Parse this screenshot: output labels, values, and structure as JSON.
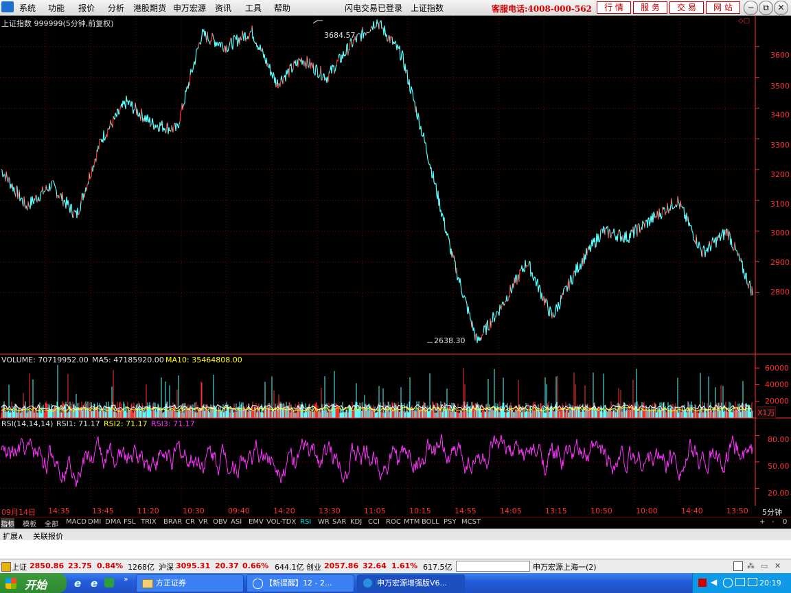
{
  "menu": {
    "items": [
      "系统",
      "功能",
      "报价",
      "分析",
      "港股期货",
      "申万宏源",
      "资讯",
      "工具",
      "帮助"
    ],
    "center_status": "闪电交易已登录",
    "center_title": "上证指数",
    "hotline": "客服电话:4008-000-562",
    "top_buttons": [
      "行 情",
      "服 务",
      "交 易",
      "网 站"
    ],
    "window_buttons": [
      "−",
      "⧉",
      "✕"
    ]
  },
  "chart": {
    "header": "上证指数 999999(5分钟,前复权)",
    "high_label": "3684.57",
    "low_label": "2638.30",
    "price_ticks": [
      "3600",
      "3500",
      "3400",
      "3300",
      "3200",
      "3100",
      "3000",
      "2900",
      "2800"
    ],
    "volume_header": {
      "volume": "VOLUME: 70719952.00",
      "ma5": "MA5: 47185920.00",
      "ma10": "MA10: 35464808.00"
    },
    "volume_ticks": [
      "60000",
      "40000",
      "20000"
    ],
    "volume_unit": "X1万",
    "rsi_header": {
      "name": "RSI(14,14,14)",
      "rsi1": "RSI1: 71.17",
      "rsi2": "RSI2: 71.17",
      "rsi3": "RSI3: 71.17"
    },
    "rsi_ticks": [
      "80.00",
      "50.00",
      "20.00"
    ],
    "time_labels": [
      "09月14日",
      "14:35",
      "13:45",
      "11:20",
      "10:30",
      "09:40",
      "14:20",
      "13:30",
      "11:05",
      "10:15",
      "14:55",
      "14:05",
      "13:15",
      "10:50",
      "10:00",
      "14:40",
      "13:50"
    ],
    "period": "5分钟",
    "colors": {
      "up": "#ff3232",
      "down": "#54ffff",
      "ma5": "#ffffff",
      "ma10": "#ffff00",
      "rsi": "#ff33ff",
      "grid": "#7a0000",
      "axis": "#ff3232"
    }
  },
  "chart_data": {
    "type": "line",
    "title": "上证指数 999999(5分钟,前复权)",
    "ylabel": "",
    "ylim": [
      2600,
      3700
    ],
    "x": [
      "09月14日",
      "14:35",
      "13:45",
      "11:20",
      "10:30",
      "09:40",
      "14:20",
      "13:30",
      "11:05",
      "10:15",
      "14:55",
      "14:05",
      "13:15",
      "10:50",
      "10:00",
      "14:40",
      "13:50"
    ],
    "series": [
      {
        "values": [
          3200,
          3080,
          3150,
          3050,
          3300,
          3420,
          3350,
          3330,
          3640,
          3600,
          3650,
          3480,
          3560,
          3500,
          3610,
          3684,
          3570,
          3260,
          2920,
          2640,
          2760,
          2900,
          2720,
          2880,
          3000,
          2980,
          3040,
          3100,
          2930,
          3000,
          2800
        ]
      }
    ],
    "annotations": [
      {
        "text": "3684.57",
        "y": 3684.57
      },
      {
        "text": "2638.30",
        "y": 2638.3
      }
    ],
    "volume_ylim": [
      0,
      70000
    ],
    "rsi_ylim": [
      0,
      100
    ],
    "rsi_ticks": [
      80,
      50,
      20
    ]
  },
  "tabs": [
    "指标",
    "模板",
    "全部",
    "MACD",
    "DMI",
    "DMA",
    "FSL",
    "TRIX",
    "BRAR",
    "CR",
    "VR",
    "OBV",
    "ASI",
    "EMV",
    "VOL-TDX",
    "RSI",
    "WR",
    "SAR",
    "KDJ",
    "CCI",
    "ROC",
    "MTM",
    "BOLL",
    "PSY",
    "MCST"
  ],
  "tab_right": [
    "+",
    "-",
    "0"
  ],
  "ext_tabs": [
    "扩展∧",
    "关联报价"
  ],
  "status": {
    "sh_name": "上证",
    "sh_price": "2850.86",
    "sh_chg": "23.75",
    "sh_pct": "0.84%",
    "sh_amt": "1268亿",
    "hs_name": "沪深",
    "hs_price": "3095.31",
    "hs_chg": "20.37",
    "hs_pct": "0.66%",
    "hs_amt": "644.1亿",
    "cy_name": "创业",
    "cy_price": "2057.86",
    "cy_chg": "32.64",
    "cy_pct": "1.61%",
    "cy_amt": "617.5亿",
    "server": "申万宏源上海一(2)"
  },
  "taskbar": {
    "start": "开始",
    "tasks": [
      "方正证券",
      "【新提醒】12 - 2...",
      "申万宏源增强版V6..."
    ],
    "clock": "20:19"
  }
}
